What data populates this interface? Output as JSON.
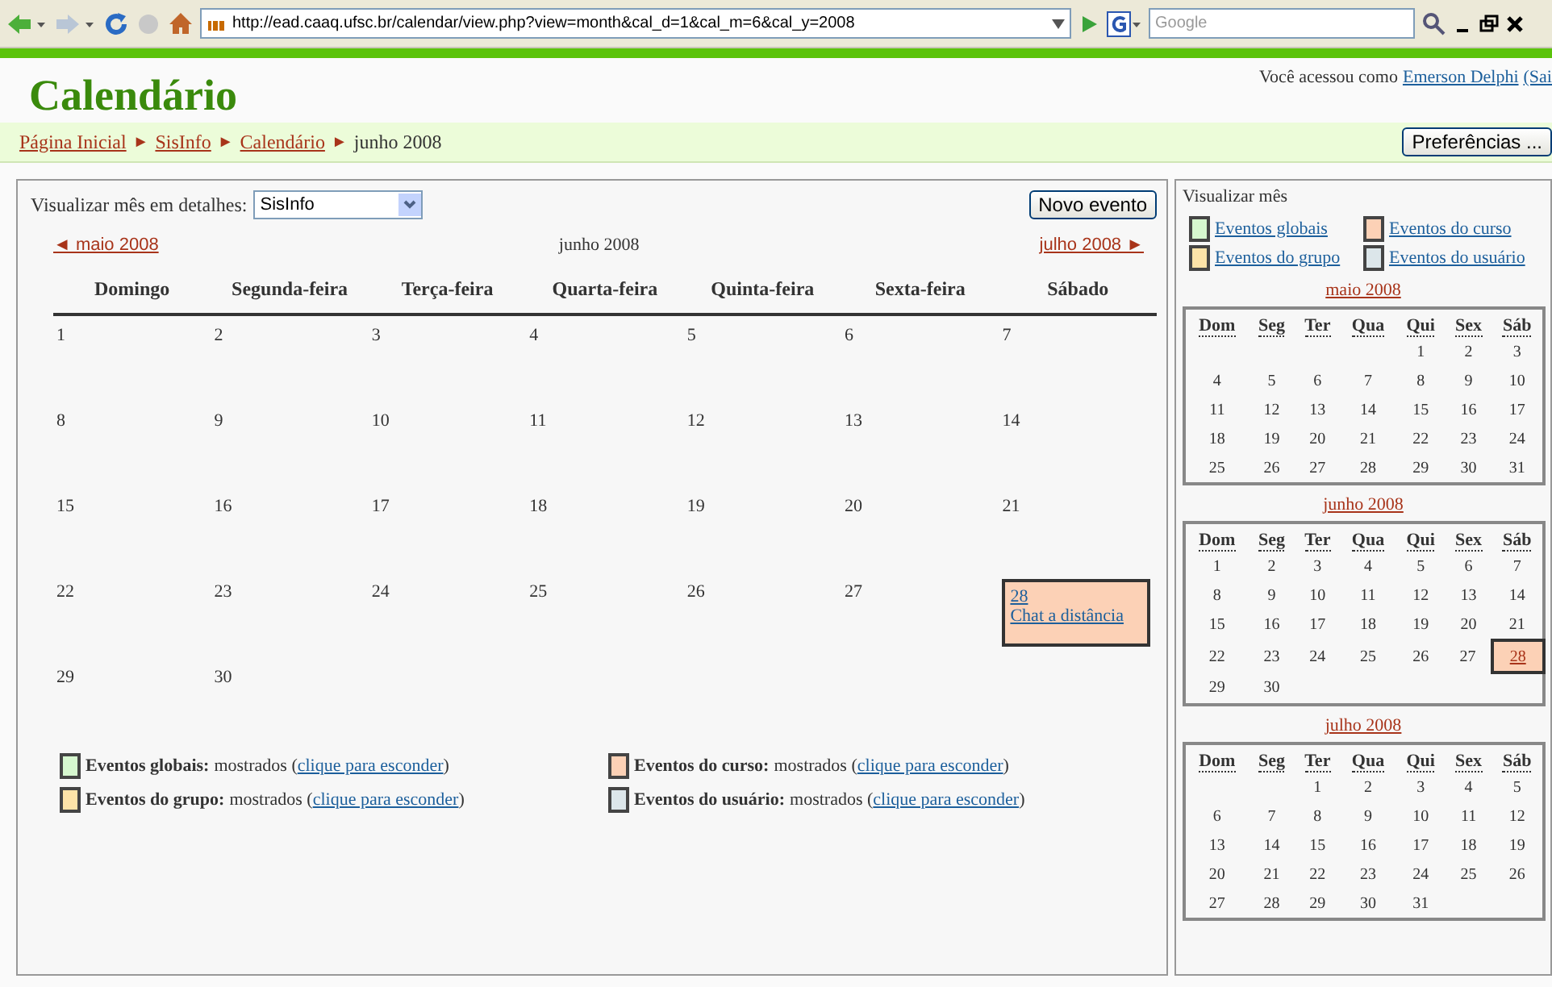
{
  "browser": {
    "url": "http://ead.caaq.ufsc.br/calendar/view.php?view=month&cal_d=1&cal_m=6&cal_y=2008",
    "search_placeholder": "Google"
  },
  "header": {
    "title": "Calendário",
    "login_text": "Você acessou como",
    "user": "Emerson Delphi",
    "logout": "(Sai"
  },
  "breadcrumb": {
    "separator": "►",
    "items": [
      {
        "label": "Página Inicial",
        "link": true
      },
      {
        "label": "SisInfo",
        "link": true
      },
      {
        "label": "Calendário",
        "link": true
      },
      {
        "label": "junho 2008",
        "link": false
      }
    ]
  },
  "preferences_button": "Preferências ...",
  "main": {
    "course_label": "Visualizar mês em detalhes:",
    "course_select": "SisInfo",
    "new_event_button": "Novo evento",
    "prev": "◄ maio 2008",
    "current": "junho 2008",
    "next": "julho 2008 ►",
    "weekdays": [
      "Domingo",
      "Segunda-feira",
      "Terça-feira",
      "Quarta-feira",
      "Quinta-feira",
      "Sexta-feira",
      "Sábado"
    ],
    "weeks": [
      {
        "kind": "week",
        "days": [
          "1",
          "2",
          "3",
          "4",
          "5",
          "6",
          "7"
        ]
      },
      {
        "kind": "week",
        "days": [
          "8",
          "9",
          "10",
          "11",
          "12",
          "13",
          "14"
        ]
      },
      {
        "kind": "week",
        "days": [
          "15",
          "16",
          "17",
          "18",
          "19",
          "20",
          "21"
        ]
      },
      {
        "kind": "week",
        "days": [
          "22",
          "23",
          "24",
          "25",
          "26",
          "27",
          {
            "day": "28",
            "event": "Chat a distância",
            "color": "#fcd1b6"
          }
        ]
      },
      {
        "kind": "week",
        "days": [
          "29",
          "30"
        ]
      }
    ],
    "legend": [
      {
        "label": "Eventos globais:",
        "status": "mostrados (",
        "action": "clique para esconder",
        "after": ")",
        "color": "#d6f7cf"
      },
      {
        "label": "Eventos do curso:",
        "status": "mostrados (",
        "action": "clique para esconder",
        "after": ")",
        "color": "#fcd1b6"
      },
      {
        "label": "Eventos do grupo:",
        "status": "mostrados (",
        "action": "clique para esconder",
        "after": ")",
        "color": "#fde3a8"
      },
      {
        "label": "Eventos do usuário:",
        "status": "mostrados (",
        "action": "clique para esconder",
        "after": ")",
        "color": "#dce6ea"
      }
    ]
  },
  "sidebar": {
    "title": "Visualizar mês",
    "legend": [
      {
        "label": "Eventos globais",
        "color": "#d6f7cf"
      },
      {
        "label": "Eventos do curso",
        "color": "#fcd1b6"
      },
      {
        "label": "Eventos do grupo",
        "color": "#fde3a8"
      },
      {
        "label": "Eventos do usuário",
        "color": "#dce6ea"
      }
    ],
    "months": [
      {
        "title": "maio 2008",
        "weekdays": [
          "Dom",
          "Seg",
          "Ter",
          "Qua",
          "Qui",
          "Sex",
          "Sáb"
        ],
        "weeks": [
          {
            "kind": "first",
            "days": [
              "1",
              "2",
              "3"
            ]
          },
          {
            "kind": "week",
            "days": [
              "4",
              "5",
              "6",
              "7",
              "8",
              "9",
              "10"
            ]
          },
          {
            "kind": "week",
            "days": [
              "11",
              "12",
              "13",
              "14",
              "15",
              "16",
              "17"
            ]
          },
          {
            "kind": "week",
            "days": [
              "18",
              "19",
              "20",
              "21",
              "22",
              "23",
              "24"
            ]
          },
          {
            "kind": "week",
            "days": [
              "25",
              "26",
              "27",
              "28",
              "29",
              "30",
              "31"
            ]
          }
        ]
      },
      {
        "title": "junho 2008",
        "weekdays": [
          "Dom",
          "Seg",
          "Ter",
          "Qua",
          "Qui",
          "Sex",
          "Sáb"
        ],
        "weeks": [
          {
            "kind": "week",
            "days": [
              "1",
              "2",
              "3",
              "4",
              "5",
              "6",
              "7"
            ]
          },
          {
            "kind": "week",
            "days": [
              "8",
              "9",
              "10",
              "11",
              "12",
              "13",
              "14"
            ]
          },
          {
            "kind": "week",
            "days": [
              "15",
              "16",
              "17",
              "18",
              "19",
              "20",
              "21"
            ]
          },
          {
            "kind": "week",
            "days": [
              "22",
              "23",
              "24",
              "25",
              "26",
              "27",
              {
                "day": "28",
                "color": "#fcd1b6"
              }
            ]
          },
          {
            "kind": "week",
            "days": [
              "29",
              "30"
            ]
          }
        ]
      },
      {
        "title": "julho 2008",
        "weekdays": [
          "Dom",
          "Seg",
          "Ter",
          "Qua",
          "Qui",
          "Sex",
          "Sáb"
        ],
        "weeks": [
          {
            "kind": "first",
            "days": [
              "1",
              "2",
              "3",
              "4",
              "5"
            ]
          },
          {
            "kind": "week",
            "days": [
              "6",
              "7",
              "8",
              "9",
              "10",
              "11",
              "12"
            ]
          },
          {
            "kind": "week",
            "days": [
              "13",
              "14",
              "15",
              "16",
              "17",
              "18",
              "19"
            ]
          },
          {
            "kind": "week",
            "days": [
              "20",
              "21",
              "22",
              "23",
              "24",
              "25",
              "26"
            ]
          },
          {
            "kind": "week",
            "days": [
              "27",
              "28",
              "29",
              "30",
              "31"
            ]
          }
        ]
      }
    ]
  }
}
